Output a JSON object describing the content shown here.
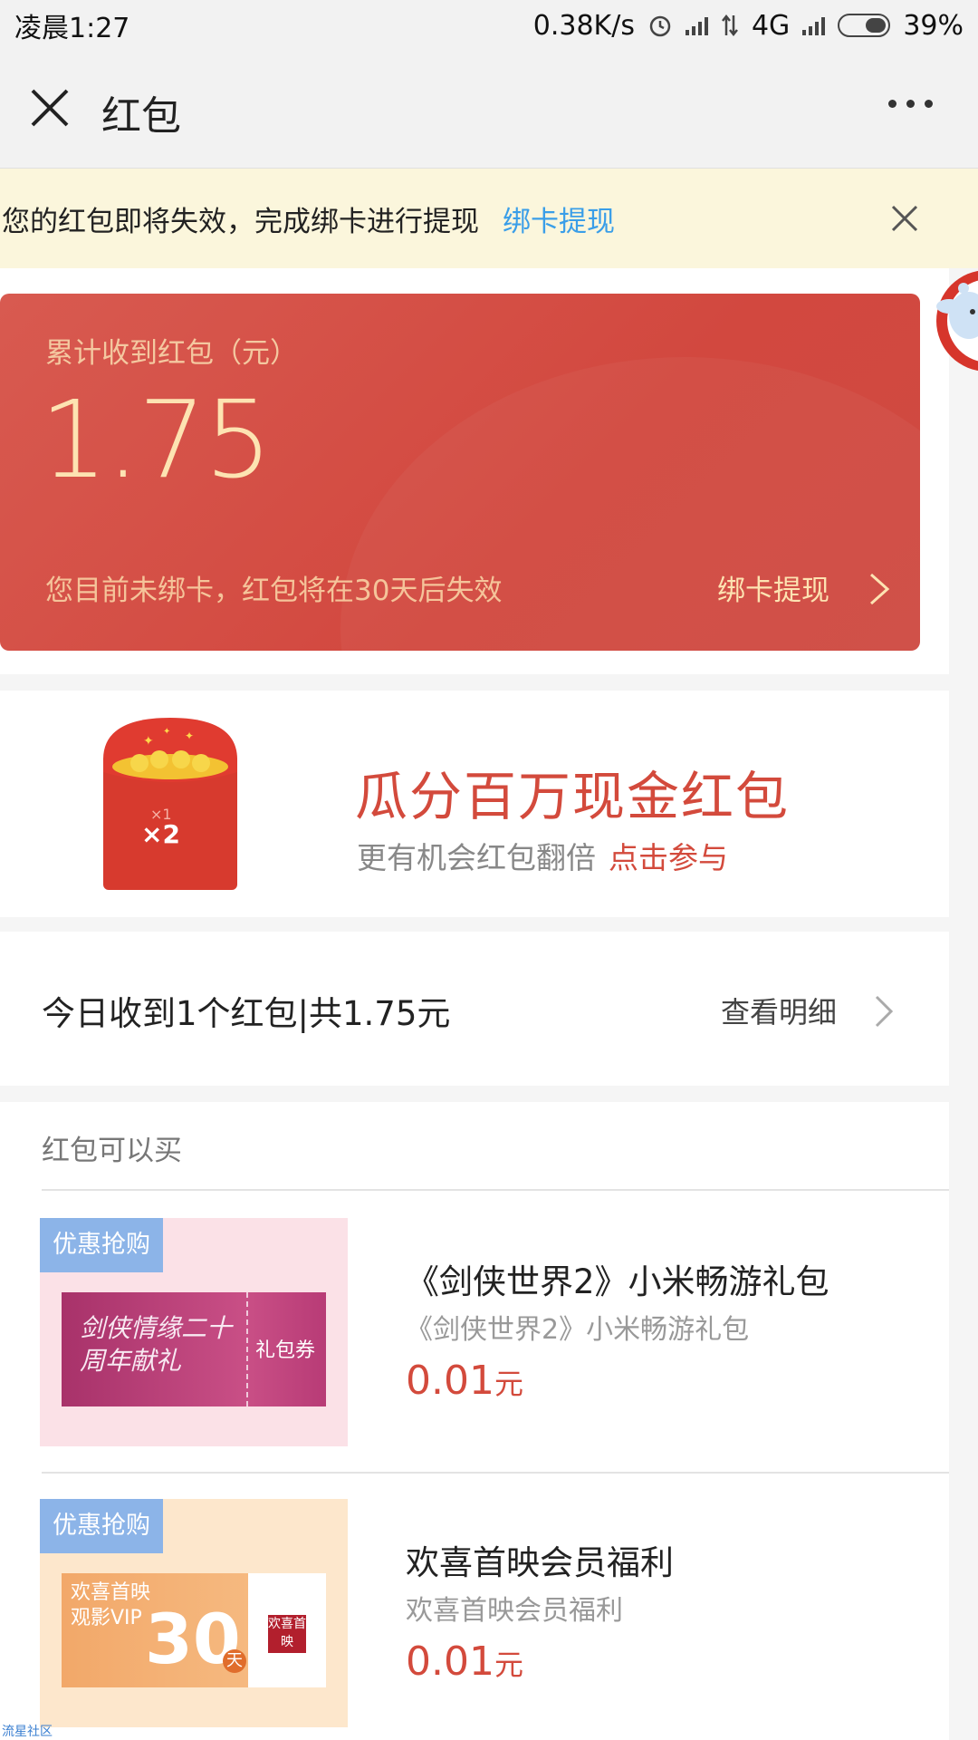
{
  "status": {
    "time": "凌晨1:27",
    "speed": "0.38K/s",
    "network": "4G",
    "battery": "39%",
    "battery_level": 0.39,
    "icons": [
      "alarm-icon",
      "signal-icon",
      "data-arrows-icon",
      "signal-icon",
      "battery-icon"
    ]
  },
  "header": {
    "title": "红包",
    "close_icon": "close-icon",
    "more_icon": "more-icon"
  },
  "notice": {
    "message": "您的红包即将失效，完成绑卡进行提现",
    "link": "绑卡提现"
  },
  "card": {
    "label": "累计收到红包（元）",
    "amount": "1.75",
    "warning": "您目前未绑卡，红包将在30天后失效",
    "action": "绑卡提现"
  },
  "promo": {
    "envelope_text": "×2",
    "envelope_small": "×1",
    "title": "瓜分百万现金红包",
    "subtitle": "更有机会红包翻倍",
    "cta": "点击参与"
  },
  "today": {
    "summary": "今日收到1个红包|共1.75元",
    "detail": "查看明细"
  },
  "shop": {
    "title": "红包可以买",
    "items": [
      {
        "badge": "优惠抢购",
        "image_text": "剑侠情缘二十周年献礼",
        "image_label": "礼包券",
        "name": "《剑侠世界2》小米畅游礼包",
        "sub": "《剑侠世界2》小米畅游礼包",
        "price": "0.01",
        "unit": "元"
      },
      {
        "badge": "优惠抢购",
        "image_text": "欢喜首映观影VIP",
        "image_big": "30",
        "image_day": "天",
        "image_logo": "欢喜首映",
        "name": "欢喜首映会员福利",
        "sub": "欢喜首映会员福利",
        "price": "0.01",
        "unit": "元"
      }
    ]
  },
  "watermark": "流星社区",
  "colors": {
    "accent_red": "#d34a3c",
    "card_red": "#d2483f",
    "link_blue": "#3a9ee8",
    "notice_bg": "#fbf6dc"
  }
}
